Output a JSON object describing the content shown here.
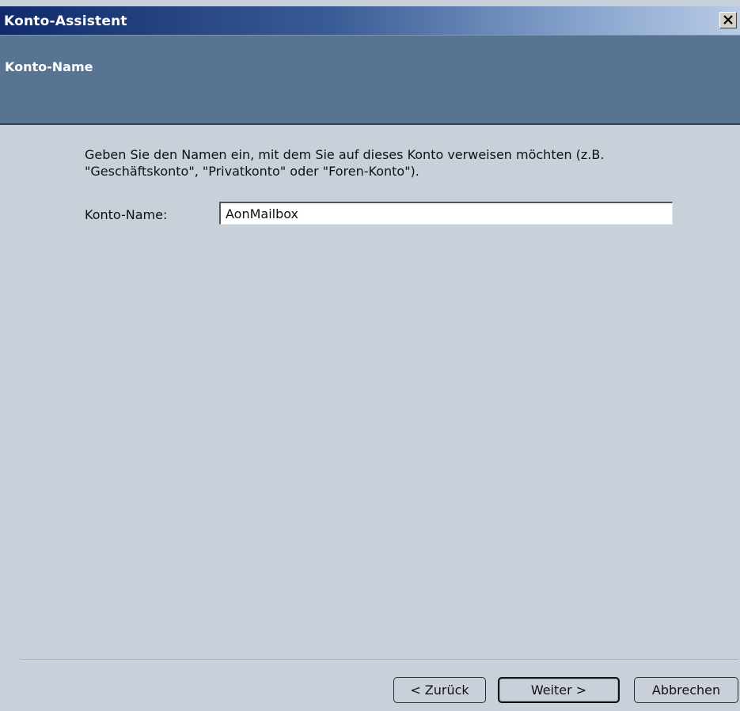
{
  "window": {
    "title": "Konto-Assistent"
  },
  "header": {
    "title": "Konto-Name"
  },
  "main": {
    "instructions": "Geben Sie den Namen ein, mit dem Sie auf dieses Konto verweisen möchten (z.B. \"Geschäftskonto\", \"Privatkonto\" oder \"Foren-Konto\").",
    "account_name_label": "Konto-Name:",
    "account_name_value": "AonMailbox"
  },
  "footer": {
    "back_label": "< Zurück",
    "next_label": "Weiter >",
    "cancel_label": "Abbrechen"
  },
  "colors": {
    "titlebar_start": "#102a6b",
    "header_band": "#597492",
    "dialog_background": "#c8d0d9"
  },
  "icons": {
    "close": "close-icon"
  }
}
